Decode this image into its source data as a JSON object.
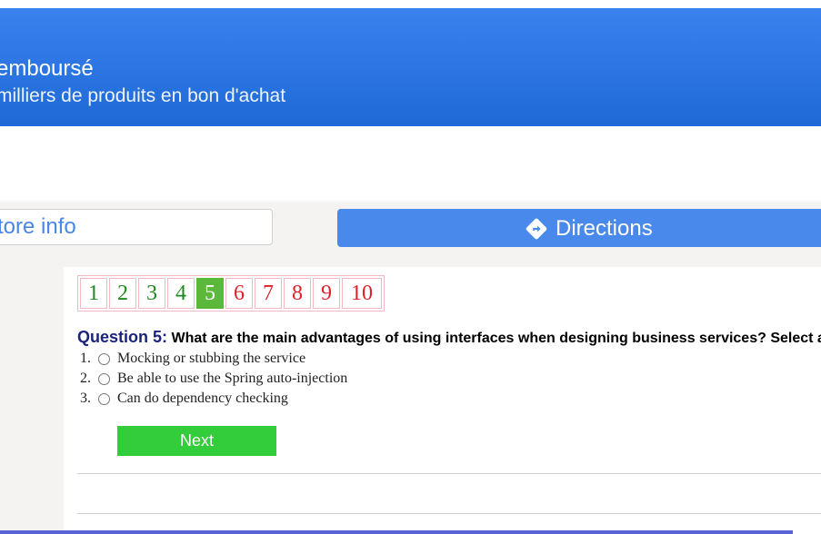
{
  "banner": {
    "title": "emboursé",
    "subtitle": "milliers de produits en bon d'achat"
  },
  "actions": {
    "store_info_label": "tore info",
    "directions_label": "Directions",
    "directions_icon": "directions-diamond-icon"
  },
  "quiz": {
    "pages": [
      {
        "label": "1",
        "state": "done"
      },
      {
        "label": "2",
        "state": "done"
      },
      {
        "label": "3",
        "state": "done"
      },
      {
        "label": "4",
        "state": "done"
      },
      {
        "label": "5",
        "state": "current"
      },
      {
        "label": "6",
        "state": "todo"
      },
      {
        "label": "7",
        "state": "todo"
      },
      {
        "label": "8",
        "state": "todo"
      },
      {
        "label": "9",
        "state": "todo"
      },
      {
        "label": "10",
        "state": "todo"
      }
    ],
    "question_label": "Question 5:",
    "question_text": "What are the main advantages of using interfaces when designing business services? Select answ",
    "answers": [
      {
        "num": "1.",
        "text": "Mocking or stubbing the service"
      },
      {
        "num": "2.",
        "text": "Be able to use the Spring auto-injection"
      },
      {
        "num": "3.",
        "text": "Can do dependency checking"
      }
    ],
    "next_label": "Next"
  },
  "colors": {
    "banner_blue": "#2a76e2",
    "directions_blue": "#4a89ec",
    "done_green": "#1f8a1f",
    "todo_red": "#e0202a",
    "current_green": "#5cb83a",
    "next_green": "#33cc3a",
    "question_navy": "#1a237e"
  }
}
